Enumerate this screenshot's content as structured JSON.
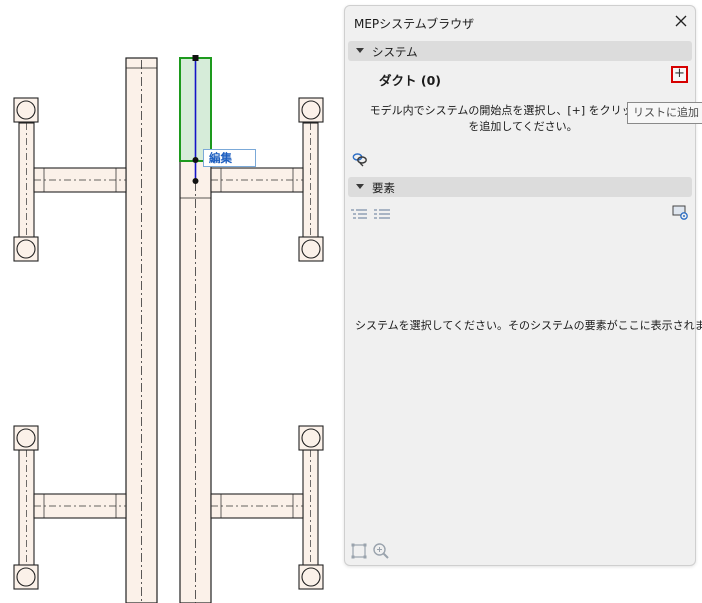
{
  "drawing": {
    "edit_tag": "編集",
    "colors": {
      "duct_fill": "#fbf1e9",
      "line": "#222222",
      "selection": "#1d9a1d",
      "selection_fill": "#d6ecd9",
      "axis": "#1515c8"
    }
  },
  "palette": {
    "title": "MEPシステムブラウザ",
    "close_icon": "close-icon",
    "system_section": {
      "label": "システム"
    },
    "duct_group": {
      "label": "ダクト (0)"
    },
    "add_button": {
      "label": "+",
      "tooltip": "リストに追加",
      "highlight_color": "#d60000"
    },
    "instruction_line1": "モデル内でシステムの開始点を選択し、[+] をクリックして新",
    "instruction_line2": "を追加してください。",
    "elements_section": {
      "label": "要素"
    },
    "empty_message": "システムを選択してください。そのシステムの要素がここに表示されます。",
    "icons": [
      "link-systems-icon",
      "list-tree-icon",
      "list-flat-icon",
      "settings-icon",
      "select-frame-icon",
      "zoom-to-icon"
    ]
  }
}
